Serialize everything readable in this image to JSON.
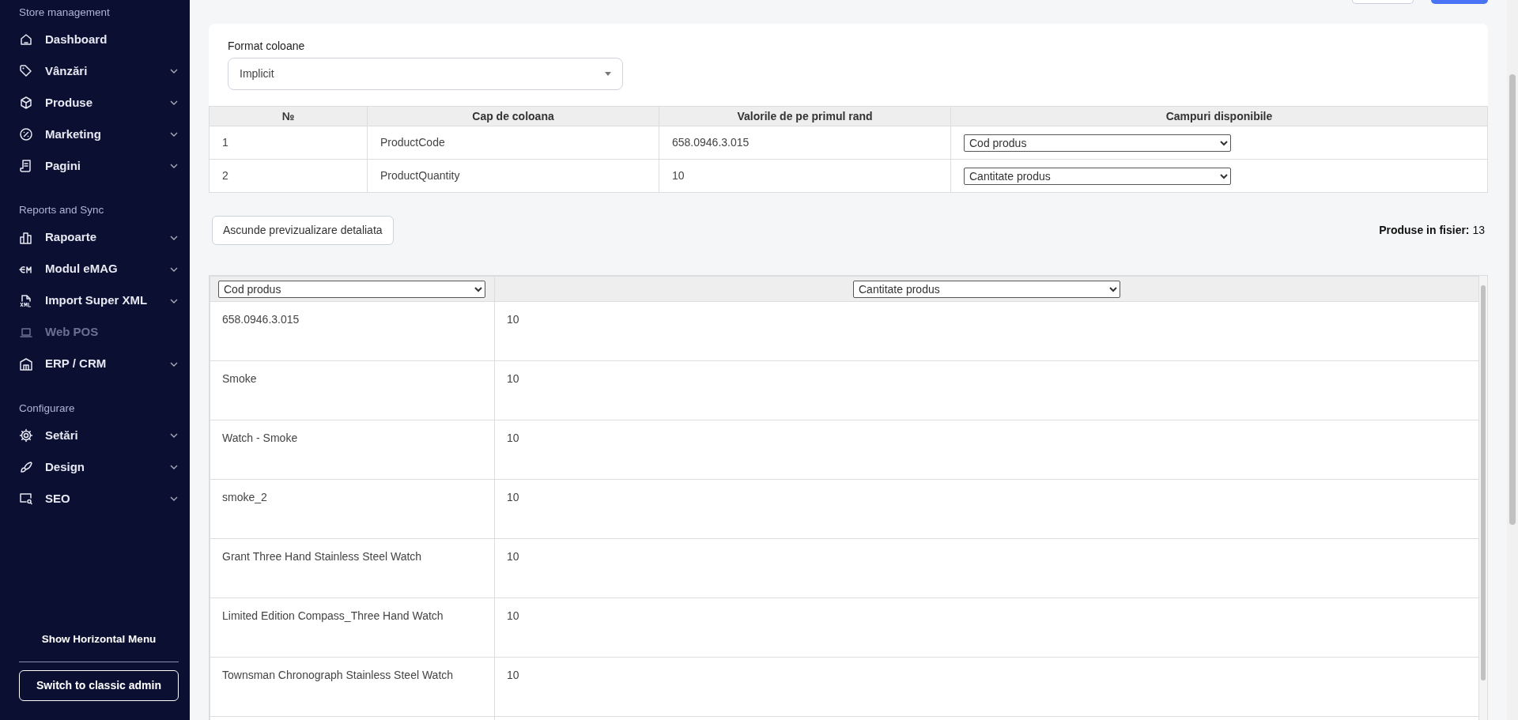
{
  "sidebar": {
    "sections": [
      {
        "title": "Store management",
        "items": [
          {
            "label": "Dashboard",
            "has_submenu": false,
            "disabled": false
          },
          {
            "label": "Vânzări",
            "has_submenu": true,
            "disabled": false
          },
          {
            "label": "Produse",
            "has_submenu": true,
            "disabled": false
          },
          {
            "label": "Marketing",
            "has_submenu": true,
            "disabled": false
          },
          {
            "label": "Pagini",
            "has_submenu": true,
            "disabled": false
          }
        ]
      },
      {
        "title": "Reports and Sync",
        "items": [
          {
            "label": "Rapoarte",
            "has_submenu": true,
            "disabled": false
          },
          {
            "label": "Modul eMAG",
            "has_submenu": true,
            "disabled": false
          },
          {
            "label": "Import Super XML",
            "has_submenu": true,
            "disabled": false
          },
          {
            "label": "Web POS",
            "has_submenu": false,
            "disabled": true
          },
          {
            "label": "ERP / CRM",
            "has_submenu": true,
            "disabled": false
          }
        ]
      },
      {
        "title": "Configurare",
        "items": [
          {
            "label": "Setări",
            "has_submenu": true,
            "disabled": false
          },
          {
            "label": "Design",
            "has_submenu": true,
            "disabled": false
          },
          {
            "label": "SEO",
            "has_submenu": true,
            "disabled": false
          }
        ]
      }
    ],
    "horizontal_menu_link": "Show Horizontal Menu",
    "classic_admin_button": "Switch to classic admin"
  },
  "format": {
    "label": "Format coloane",
    "value": "Implicit"
  },
  "mapping_table": {
    "columns": [
      "№",
      "Cap de coloana",
      "Valorile de pe primul rand",
      "Campuri disponibile"
    ],
    "rows": [
      {
        "number": "1",
        "header": "ProductCode",
        "first_value": "658.0946.3.015",
        "field": "Cod produs"
      },
      {
        "number": "2",
        "header": "ProductQuantity",
        "first_value": "10",
        "field": "Cantitate produs"
      }
    ]
  },
  "toggle_preview_button": "Ascunde previzualizare detaliata",
  "products_count": {
    "label": "Produse in fisier:",
    "value": "13"
  },
  "preview": {
    "column_fields": [
      "Cod produs",
      "Cantitate produs"
    ],
    "rows": [
      [
        "658.0946.3.015",
        "10"
      ],
      [
        "Smoke",
        "10"
      ],
      [
        "Watch - Smoke",
        "10"
      ],
      [
        "smoke_2",
        "10"
      ],
      [
        "Grant Three Hand Stainless Steel Watch",
        "10"
      ],
      [
        "Limited Edition Compass_Three Hand Watch",
        "10"
      ],
      [
        "Townsman Chronograph Stainless Steel Watch",
        "10"
      ]
    ]
  }
}
